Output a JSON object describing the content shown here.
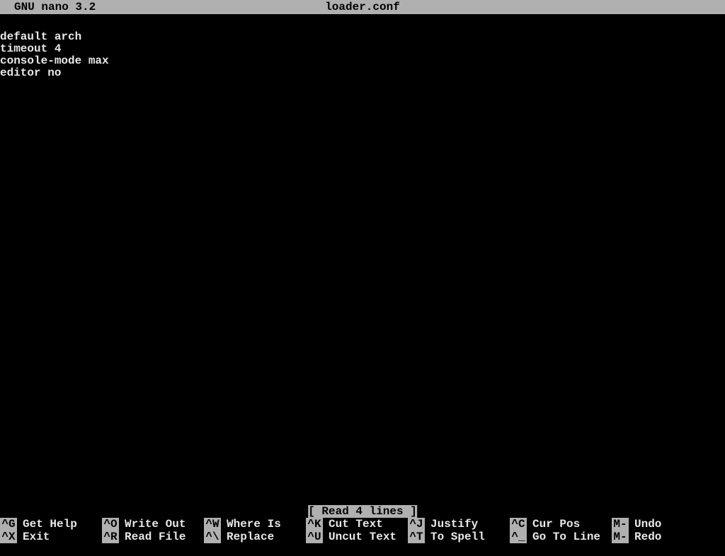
{
  "titlebar": {
    "app_name": "GNU nano 3.2",
    "filename": "loader.conf"
  },
  "editor": {
    "lines": [
      "default arch",
      "timeout 4",
      "console-mode max",
      "editor no"
    ]
  },
  "status": {
    "message": "[ Read 4 lines ]"
  },
  "shortcuts": {
    "row1": [
      {
        "key": "^G",
        "label": "Get Help"
      },
      {
        "key": "^O",
        "label": "Write Out"
      },
      {
        "key": "^W",
        "label": "Where Is"
      },
      {
        "key": "^K",
        "label": "Cut Text"
      },
      {
        "key": "^J",
        "label": "Justify"
      },
      {
        "key": "^C",
        "label": "Cur Pos"
      },
      {
        "key": "M-U",
        "label": "Undo"
      }
    ],
    "row2": [
      {
        "key": "^X",
        "label": "Exit"
      },
      {
        "key": "^R",
        "label": "Read File"
      },
      {
        "key": "^\\",
        "label": "Replace"
      },
      {
        "key": "^U",
        "label": "Uncut Text"
      },
      {
        "key": "^T",
        "label": "To Spell"
      },
      {
        "key": "^_",
        "label": "Go To Line"
      },
      {
        "key": "M-E",
        "label": "Redo"
      }
    ]
  }
}
